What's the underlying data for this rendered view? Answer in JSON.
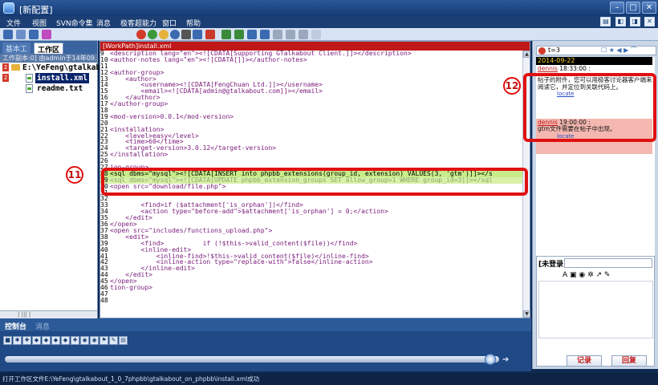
{
  "window": {
    "title": "[新配置]"
  },
  "menu": [
    "文件",
    "视图",
    "SVN命令集",
    "消息",
    "极客超能力",
    "窗口",
    "帮助"
  ],
  "left_panel": {
    "tabs": [
      "基本工",
      "工作区"
    ],
    "path": "工作副本:0] 由admin于14年09...",
    "tree": [
      {
        "badge": "2",
        "type": "folder",
        "label": "E:\\YeFeng\\gtalkab"
      },
      {
        "badge": "2",
        "type": "file",
        "label": "install.xml",
        "selected": true
      },
      {
        "type": "file",
        "label": "readme.txt"
      }
    ],
    "scroll_hint": "| ||| |"
  },
  "editor": {
    "title": "[WorkPath]install.xml",
    "lines": [
      {
        "n": "9",
        "text": "<description lang=\"en\"><![CDATA[Supporting GTalkabout Client.]]></description>"
      },
      {
        "n": "10",
        "text": "<author-notes lang=\"en\"><![CDATA[]]></author-notes>"
      },
      {
        "n": "11",
        "text": ""
      },
      {
        "n": "12",
        "text": "<author-group>"
      },
      {
        "n": "13",
        "text": "    <author>"
      },
      {
        "n": "14",
        "text": "        <username><![CDATA[FengChuan Ltd.]]></username>"
      },
      {
        "n": "15",
        "text": "        <email><![CDATA[admin@gtalkabout.com]]></email>"
      },
      {
        "n": "16",
        "text": "    </author>"
      },
      {
        "n": "17",
        "text": "</author-group>"
      },
      {
        "n": "18",
        "text": ""
      },
      {
        "n": "19",
        "text": "<mod-version>0.0.1</mod-version>"
      },
      {
        "n": "20",
        "text": ""
      },
      {
        "n": "21",
        "text": "<installation>"
      },
      {
        "n": "22",
        "text": "    <level>easy</level>"
      },
      {
        "n": "23",
        "text": "    <time>60</time>"
      },
      {
        "n": "24",
        "text": "    <target-version>3.0.12</target-version>"
      },
      {
        "n": "25",
        "text": "</installation>"
      },
      {
        "n": "26",
        "text": ""
      },
      {
        "n": "27",
        "text": "ion-group>"
      },
      {
        "n": "28",
        "text": "<sql dbms=\"mysql\"><![CDATA[INSERT into phpbb_extensions(group_id, extension) VALUES(3, 'gtm')]]></s",
        "hl": "green"
      },
      {
        "n": "29",
        "text": "<sql dbms=\"mysql\"><![CDATA[UPDATE phpbb_extension_groups SET allow_group=1 WHERE group_id=3]]></sql",
        "hl": "lime"
      },
      {
        "n": "30",
        "text": "<open src=\"download/file.php\">"
      },
      {
        "n": "31",
        "text": ""
      },
      {
        "n": "32",
        "text": ""
      },
      {
        "n": "33",
        "text": "        <find>if ($attachment['is_orphan'])</find>"
      },
      {
        "n": "34",
        "text": "        <action type=\"before-add\">$attachment['is_orphan'] = 0;</action>"
      },
      {
        "n": "35",
        "text": "    </edit>"
      },
      {
        "n": "36",
        "text": "</open>"
      },
      {
        "n": "37",
        "text": "<open src=\"includes/functions_upload.php\">"
      },
      {
        "n": "38",
        "text": "    <edit>"
      },
      {
        "n": "39",
        "text": "        <find>          if (!$this->valid_content($file))</find>"
      },
      {
        "n": "40",
        "text": "        <inline-edit>"
      },
      {
        "n": "41",
        "text": "            <inline-find>!$this->valid_content($file)</inline-find>"
      },
      {
        "n": "42",
        "text": "            <inline-action type=\"replace-with\">false</inline-action>"
      },
      {
        "n": "43",
        "text": "        </inline-edit>"
      },
      {
        "n": "44",
        "text": "    </edit>"
      },
      {
        "n": "45",
        "text": "</open>"
      },
      {
        "n": "46",
        "text": "tion-group>"
      },
      {
        "n": "47",
        "text": ""
      },
      {
        "n": "48",
        "text": ""
      }
    ]
  },
  "callouts": {
    "a": "11",
    "b": "12"
  },
  "right_panel": {
    "top_label": "t=3",
    "date": "2014-09-22",
    "msg1": {
      "user": "dennis",
      "time": "18:33:00 :",
      "text": "帖子的附件，您可以用极客讨论器客户端来阅读它，并定位到关联代码上。",
      "link": "locate"
    },
    "msg2": {
      "user": "dennis",
      "time": "19:00:00 :",
      "text": "gtm文件需要在帖子中出现。",
      "link": "locate"
    },
    "compose_header": "[未登录",
    "compose_tools": "A ▣ ◉ ✲ ↗ ✎",
    "buttons": {
      "record": "记录",
      "reply": "回复"
    }
  },
  "console": {
    "tabs": [
      "控制台",
      "消息"
    ],
    "tool_icons": [
      "■",
      "✱",
      "✚",
      "◆",
      "◆",
      "◆",
      "◆",
      "✚",
      "◉",
      "◉",
      "⚑",
      "✎",
      "▤"
    ]
  },
  "status": "打开工作区文件E:\\YeFeng\\gtalkabout_1_0_7phpbb\\gtalkabout_on_phpbb\\install.xml成功",
  "colors": {
    "accent": "#e01010",
    "window": "#1b3e74",
    "date_bg": "#000000",
    "date_fg": "#f3d02a"
  }
}
